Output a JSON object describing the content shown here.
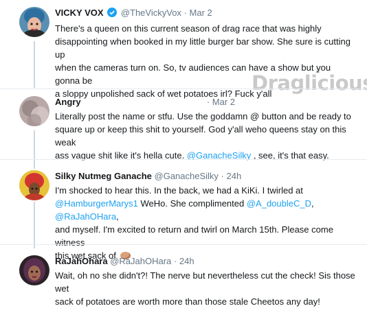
{
  "watermark": "Draglicious",
  "tweets": [
    {
      "name": "VICKY VOX",
      "handle": "@TheVickyVox",
      "sep": "·",
      "time": "Mar 2",
      "lines": [
        "There's a queen on this current season of drag race that was highly",
        "disappointing when booked in my little burger bar show. She sure is cutting up",
        "when the cameras turn on. So, tv audiences can have a show but you gonna be",
        "a sloppy unpolished sack of wet potatoes irl? Fuck y'all"
      ]
    },
    {
      "name": "Angry",
      "sep": "·",
      "time": "Mar 2",
      "lines": [
        "Literally post the name or stfu. Use the goddamn @ button and be ready to",
        "square up or keep this shit to yourself. God y'all weho queens stay on this weak",
        "ass vague shit like it's hella cute. "
      ],
      "mention": "@GanacheSilky",
      "after": " , see, it's that easy."
    },
    {
      "name": "Silky Nutmeg Ganache",
      "handle": "@GanacheSilky",
      "sep": "·",
      "time": "24h",
      "line1": "I'm shocked to hear this. In the back, we had a KiKi. I twirled at",
      "mention1": "@HamburgerMarys1",
      "text2": " WeHo. She complimented ",
      "mention2": "@A_doubleC_D",
      "text3": ", ",
      "mention3": "@RaJahOHara",
      "text4": ",",
      "line3": "and myself. I'm excited to return and twirl on March 15th. Please come witness",
      "line4": "this wet sack of"
    },
    {
      "name": "RaJahOhara",
      "handle": "@RaJahOHara",
      "sep": "·",
      "time": "24h",
      "lines": [
        "Wait, oh no she didn't?! The nerve but nevertheless cut the check! Sis those wet",
        "sack of potatoes are worth more than those stale Cheetos any day!"
      ]
    }
  ]
}
